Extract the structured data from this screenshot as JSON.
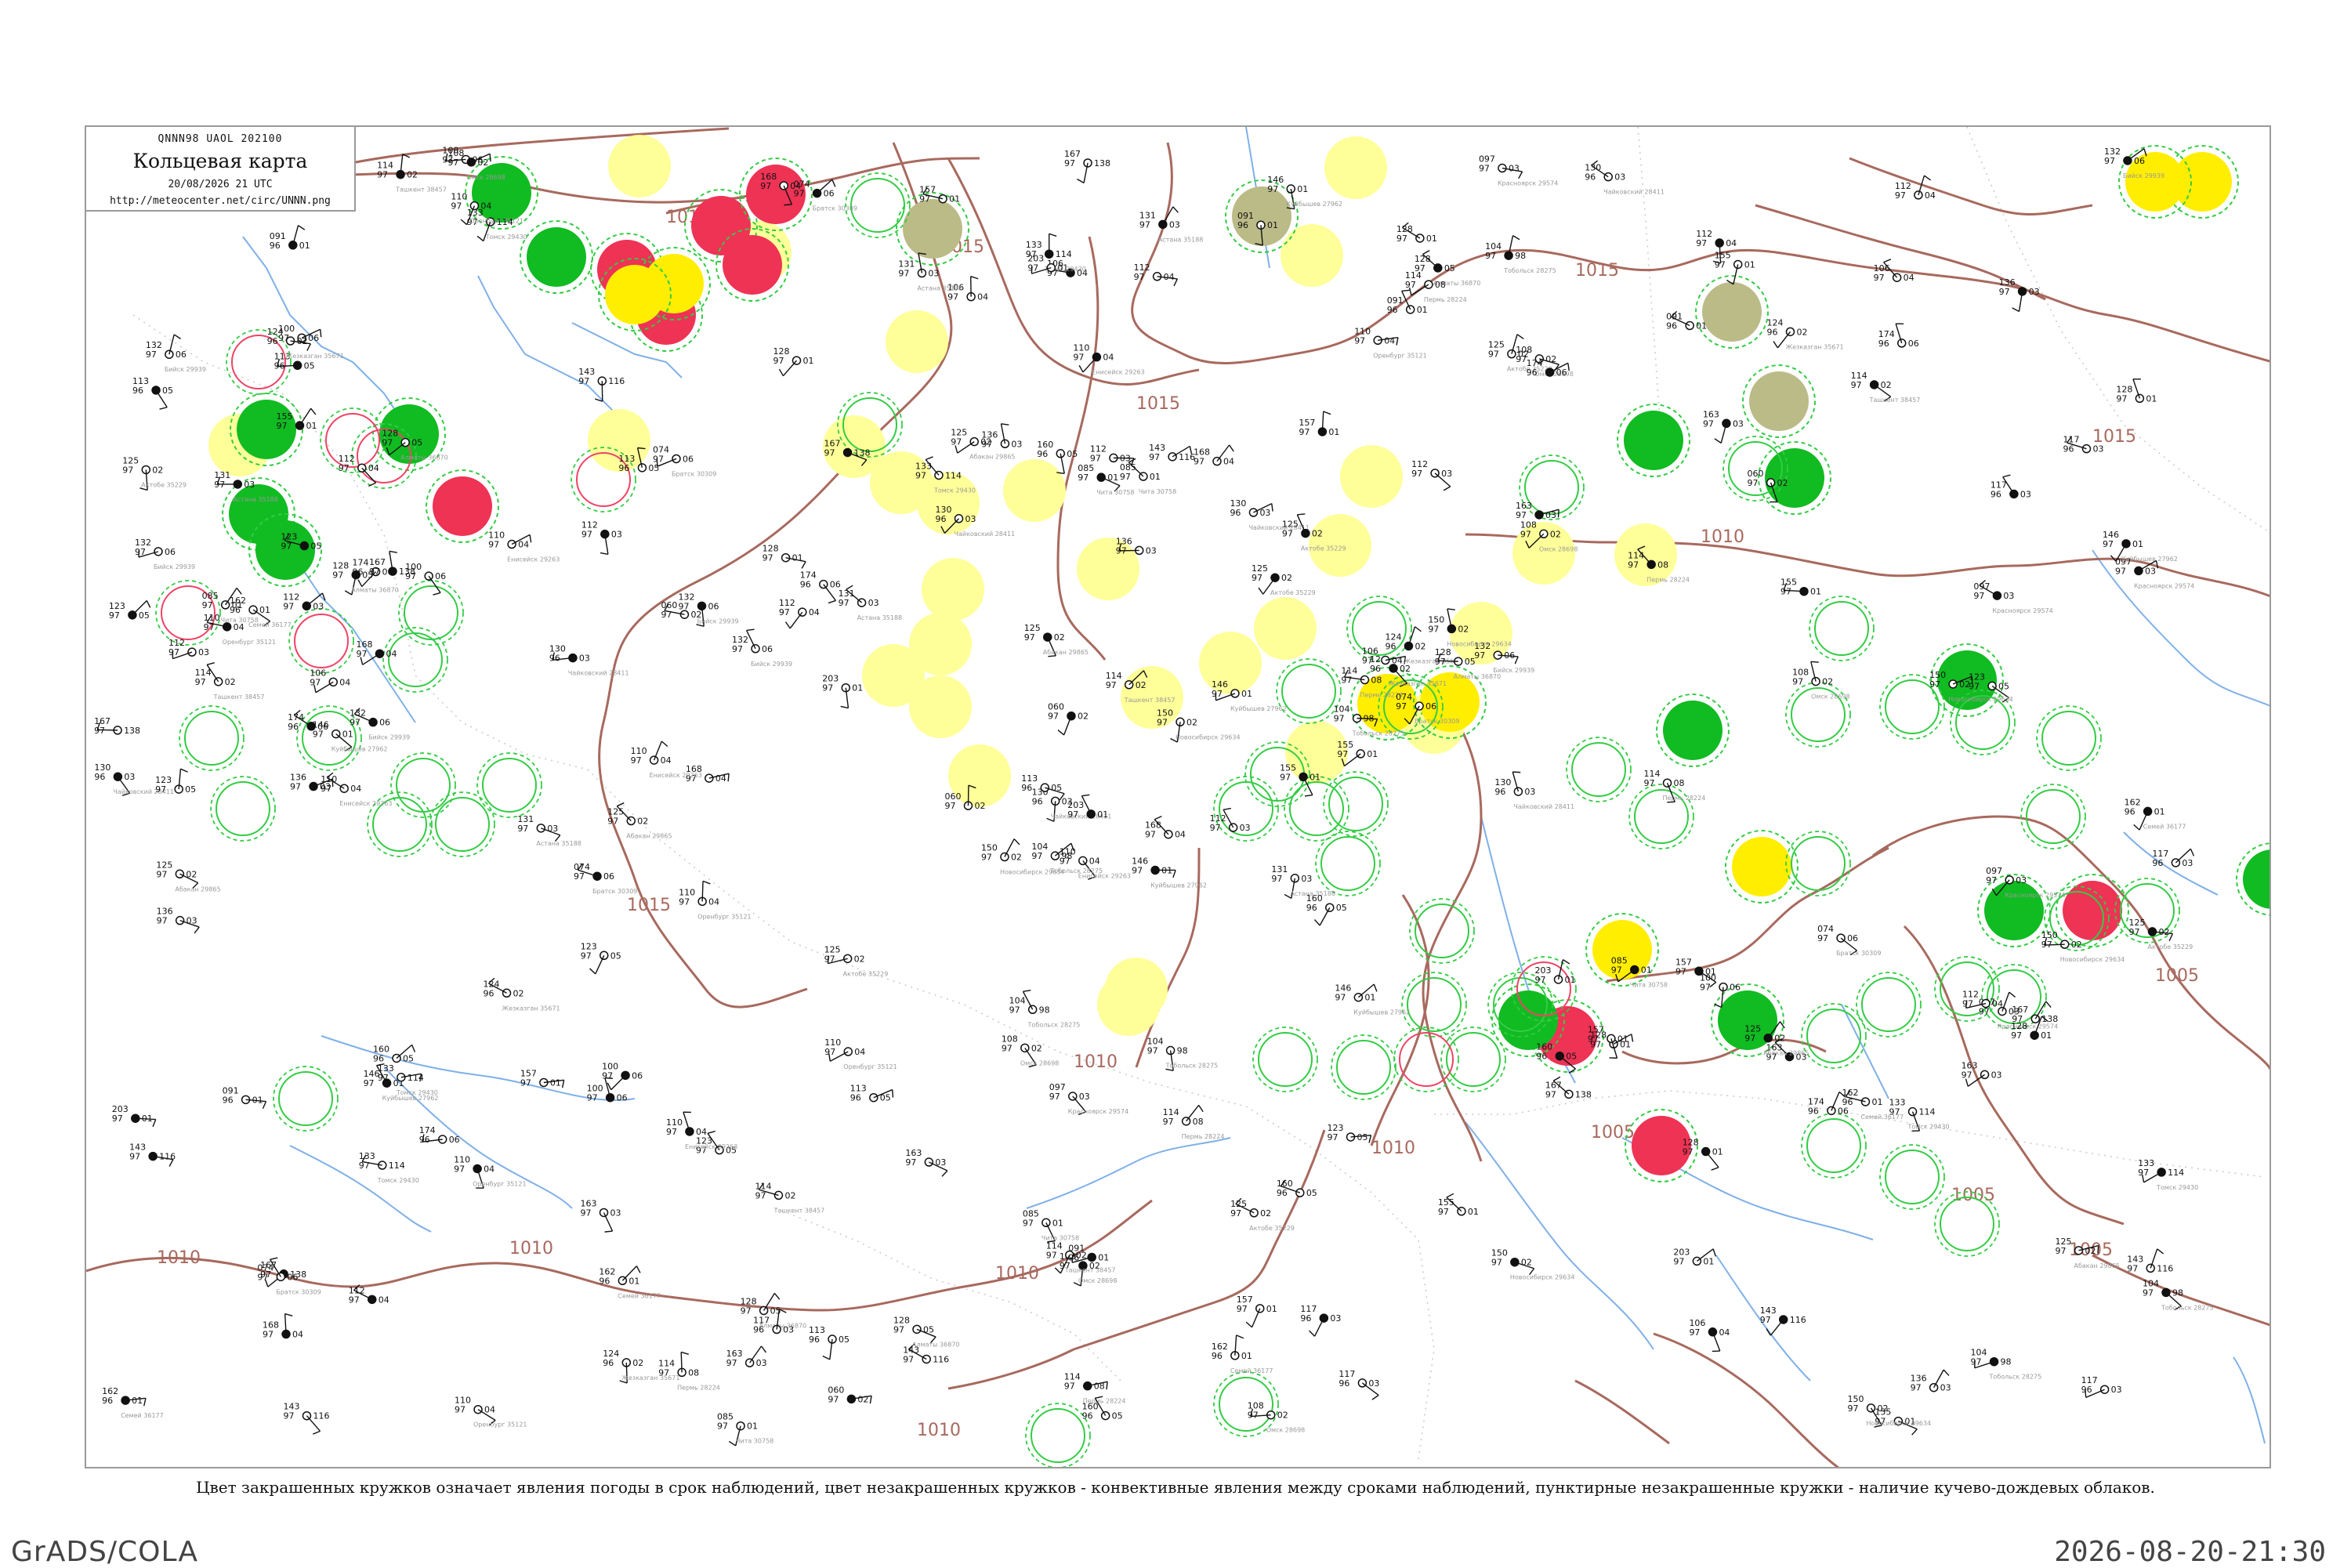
{
  "header": {
    "code_line": "QNNN98  UAOL  202100",
    "title": "Кольцевая карта",
    "date_line": "20/08/2026 21 UTC",
    "url": "http://meteocenter.net/circ/UNNN.png"
  },
  "caption": "Цвет закрашенных кружков означает явления погоды в срок наблюдений, цвет незакрашенных кружков - конвективные явления между сроками наблюдений, пунктирные незакрашенные кружки - наличие кучево-дождевых облаков.",
  "footer": {
    "left": "GrADS/COLA",
    "right": "2026-08-20-21:30"
  },
  "colors": {
    "isobar": "#a8695e",
    "river": "#7fb0e8",
    "green_fill": "#11bb22",
    "red_fill": "#ee3355",
    "yellow_fill": "#ffee00",
    "light_yellow_fill": "#ffff99",
    "olive_fill": "#bbbb88",
    "green_ring": "#33cc44",
    "red_ring": "#ee4466"
  },
  "isobar_labels": [
    "1015",
    "1015",
    "1015",
    "1015",
    "1015",
    "1015",
    "1010",
    "1010",
    "1010",
    "1010",
    "1010",
    "1010",
    "1010",
    "1005",
    "1005",
    "1005",
    "1005"
  ],
  "stations": [
    {
      "name": "Кольцевая",
      "id": "",
      "v1": "",
      "v2": "",
      "v3": ""
    }
  ],
  "circles": [
    {
      "kind": "green",
      "v": [
        "140",
        "97",
        "01"
      ]
    },
    {
      "kind": "red",
      "v": [
        "126",
        "97",
        "02"
      ]
    },
    {
      "kind": "yellow",
      "v": [
        "115",
        "96",
        "03"
      ]
    },
    {
      "kind": "lyellow",
      "v": [
        "119",
        "96",
        "01"
      ]
    },
    {
      "kind": "olive",
      "v": [
        "142",
        "06",
        "150"
      ]
    }
  ],
  "plots": [
    {
      "id": "p1",
      "v": [
        "146",
        "97",
        "01"
      ],
      "n": "Куйбышев 27962"
    },
    {
      "id": "p2",
      "v": [
        "112",
        "97",
        "04"
      ],
      "n": "Шенкурск 22837"
    },
    {
      "id": "p3",
      "v": [
        "130",
        "96",
        "03"
      ],
      "n": "Чайковский 28411"
    },
    {
      "id": "p4",
      "v": [
        "167",
        "97",
        "138"
      ],
      "n": "Сыктывкар 23804"
    },
    {
      "id": "p5",
      "v": [
        "114",
        "97",
        "08"
      ],
      "n": "Пермь 28224"
    },
    {
      "id": "p6",
      "v": [
        "123",
        "97",
        "05"
      ],
      "n": "Ухта 23711"
    },
    {
      "id": "p7",
      "v": [
        "104",
        "97",
        "98"
      ],
      "n": "Тобольск 28275"
    },
    {
      "id": "p8",
      "v": [
        "143",
        "97",
        "116"
      ],
      "n": "Курган 28661"
    },
    {
      "id": "p9",
      "v": [
        "108",
        "97",
        "02"
      ],
      "n": "Омск 28698"
    },
    {
      "id": "p10",
      "v": [
        "155",
        "97",
        "01"
      ],
      "n": "Ишим 28573"
    },
    {
      "id": "p11",
      "v": [
        "133",
        "97",
        "114"
      ],
      "n": "Томск 29430"
    },
    {
      "id": "p12",
      "v": [
        "117",
        "96",
        "03"
      ],
      "n": "Барнаул 29838"
    },
    {
      "id": "p13",
      "v": [
        "132",
        "97",
        "06"
      ],
      "n": "Бийск 29939"
    },
    {
      "id": "p14",
      "v": [
        "128",
        "97",
        "01"
      ],
      "n": "Кемерово 29642"
    },
    {
      "id": "p15",
      "v": [
        "150",
        "97",
        "02"
      ],
      "n": "Новосибирск 29634"
    },
    {
      "id": "p16",
      "v": [
        "163",
        "97",
        "03"
      ],
      "n": "Тара 28493"
    },
    {
      "id": "p17",
      "v": [
        "110",
        "97",
        "04"
      ],
      "n": "Оренбург 35121"
    },
    {
      "id": "p18",
      "v": [
        "160",
        "96",
        "05"
      ],
      "n": "Уральск 35108"
    },
    {
      "id": "p19",
      "v": [
        "125",
        "97",
        "02"
      ],
      "n": "Актобе 35229"
    },
    {
      "id": "p20",
      "v": [
        "174",
        "96",
        "06"
      ],
      "n": "Костанай 28952"
    },
    {
      "id": "p21",
      "v": [
        "131",
        "97",
        "03"
      ],
      "n": "Астана 35188"
    },
    {
      "id": "p22",
      "v": [
        "168",
        "97",
        "04"
      ],
      "n": "Павлодар 36003"
    },
    {
      "id": "p23",
      "v": [
        "162",
        "96",
        "01"
      ],
      "n": "Семей 36177"
    },
    {
      "id": "p24",
      "v": [
        "112",
        "97",
        "03"
      ],
      "n": "Караганда 35394"
    },
    {
      "id": "p25",
      "v": [
        "124",
        "96",
        "02"
      ],
      "n": "Жезказган 35671"
    },
    {
      "id": "p26",
      "v": [
        "100",
        "97",
        "06"
      ],
      "n": "Балхаш 35796"
    },
    {
      "id": "p27",
      "v": [
        "128",
        "97",
        "05"
      ],
      "n": "Алматы 36870"
    },
    {
      "id": "p28",
      "v": [
        "106",
        "97",
        "04"
      ],
      "n": "Шымкент 38328"
    },
    {
      "id": "p29",
      "v": [
        "114",
        "97",
        "02"
      ],
      "n": "Ташкент 38457"
    },
    {
      "id": "p30",
      "v": [
        "203",
        "97",
        "01"
      ],
      "n": "Нукус 38262"
    },
    {
      "id": "p31",
      "v": [
        "097",
        "97",
        "03"
      ],
      "n": "Красноярск 29574"
    },
    {
      "id": "p32",
      "v": [
        "113",
        "96",
        "05"
      ],
      "n": "Иркутск 30710"
    },
    {
      "id": "p33",
      "v": [
        "085",
        "97",
        "01"
      ],
      "n": "Чита 30758"
    },
    {
      "id": "p34",
      "v": [
        "060",
        "97",
        "02"
      ],
      "n": "Улан-Удэ 30823"
    },
    {
      "id": "p35",
      "v": [
        "074",
        "97",
        "06"
      ],
      "n": "Братск 30309"
    },
    {
      "id": "p36",
      "v": [
        "091",
        "96",
        "01"
      ],
      "n": "Туруханск 23472"
    },
    {
      "id": "p37",
      "v": [
        "110",
        "97",
        "04"
      ],
      "n": "Енисейск 29263"
    },
    {
      "id": "p38",
      "v": [
        "136",
        "97",
        "03"
      ],
      "n": "Кызыл 36096"
    },
    {
      "id": "p39",
      "v": [
        "125",
        "97",
        "02"
      ],
      "n": "Абакан 29865"
    },
    {
      "id": "p40",
      "v": [
        "157",
        "97",
        "01"
      ],
      "n": "Ханты-Мансийск 23933"
    }
  ]
}
